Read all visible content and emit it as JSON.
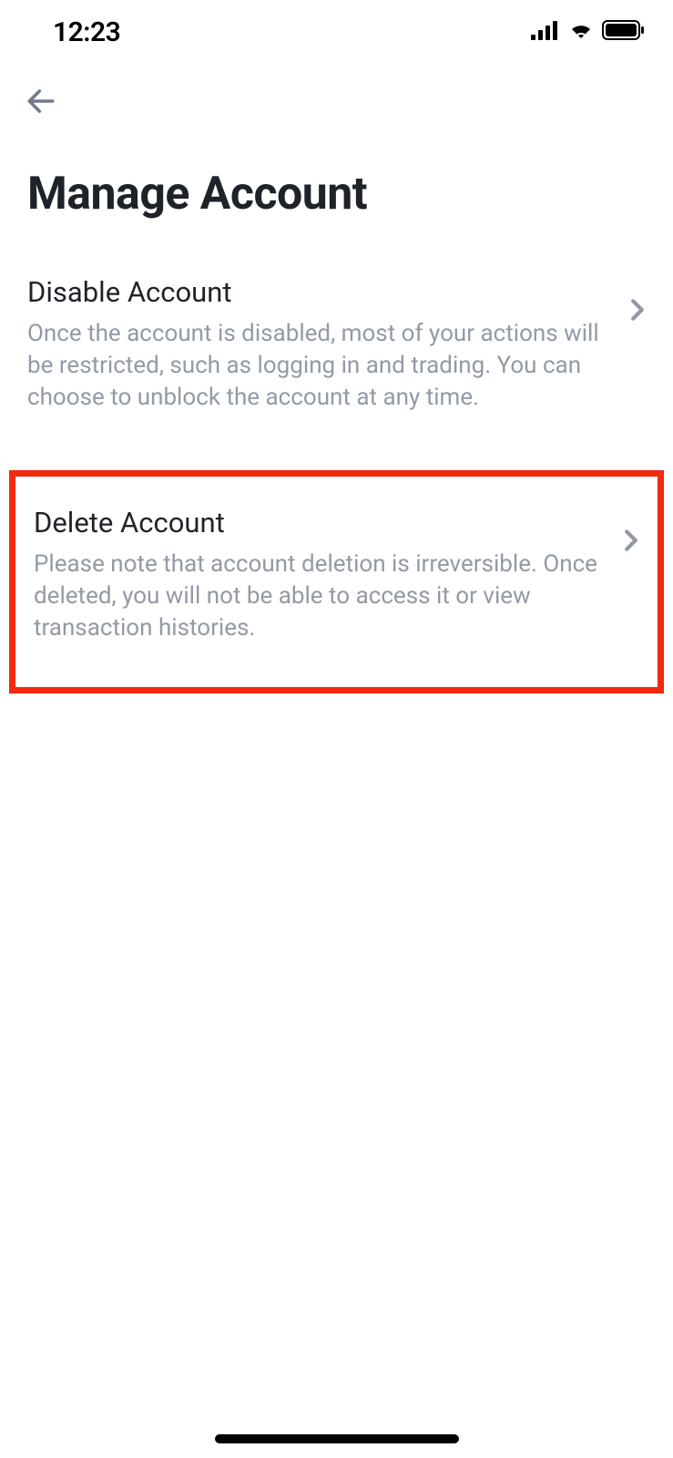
{
  "statusBar": {
    "time": "12:23"
  },
  "pageTitle": "Manage Account",
  "options": [
    {
      "title": "Disable Account",
      "description": "Once the account is disabled, most of your actions will be restricted, such as logging in and trading. You can choose to unblock the account at any time."
    },
    {
      "title": "Delete Account",
      "description": "Please note that account deletion is irreversible. Once deleted, you will not be able to access it or view transaction histories."
    }
  ]
}
